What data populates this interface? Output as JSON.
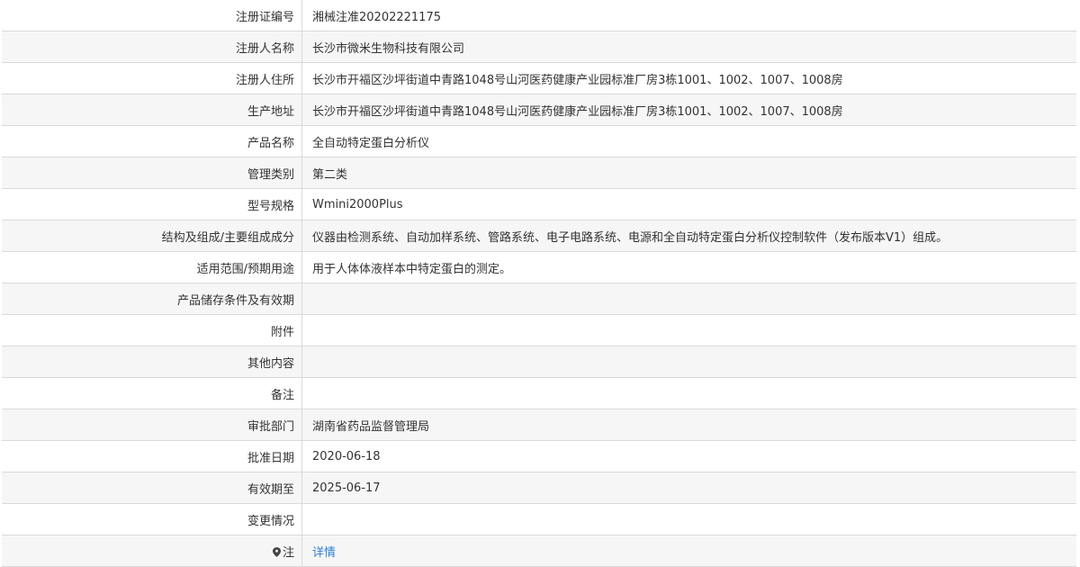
{
  "record": {
    "rows": [
      {
        "label": "注册证编号",
        "value": "湘械注准20202221175"
      },
      {
        "label": "注册人名称",
        "value": "长沙市微米生物科技有限公司"
      },
      {
        "label": "注册人住所",
        "value": "长沙市开福区沙坪街道中青路1048号山河医药健康产业园标准厂房3栋1001、1002、1007、1008房"
      },
      {
        "label": "生产地址",
        "value": "长沙市开福区沙坪街道中青路1048号山河医药健康产业园标准厂房3栋1001、1002、1007、1008房"
      },
      {
        "label": "产品名称",
        "value": "全自动特定蛋白分析仪"
      },
      {
        "label": "管理类别",
        "value": "第二类"
      },
      {
        "label": "型号规格",
        "value": "Wmini2000Plus"
      },
      {
        "label": "结构及组成/主要组成成分",
        "value": "仪器由检测系统、自动加样系统、管路系统、电子电路系统、电源和全自动特定蛋白分析仪控制软件（发布版本V1）组成。"
      },
      {
        "label": "适用范围/预期用途",
        "value": "用于人体体液样本中特定蛋白的测定。"
      },
      {
        "label": "产品储存条件及有效期",
        "value": ""
      },
      {
        "label": "附件",
        "value": ""
      },
      {
        "label": "其他内容",
        "value": ""
      },
      {
        "label": "备注",
        "value": ""
      },
      {
        "label": "审批部门",
        "value": "湖南省药品监督管理局"
      },
      {
        "label": "批准日期",
        "value": "2020-06-18"
      },
      {
        "label": "有效期至",
        "value": "2025-06-17"
      },
      {
        "label": "变更情况",
        "value": ""
      }
    ],
    "note": {
      "label": "注",
      "icon": "pin-icon",
      "link_text": "详情"
    }
  },
  "colors": {
    "row_alt_bg": "#f6f6f6",
    "border": "#d9d9d9",
    "link": "#2f7fd4",
    "text": "#333333"
  }
}
